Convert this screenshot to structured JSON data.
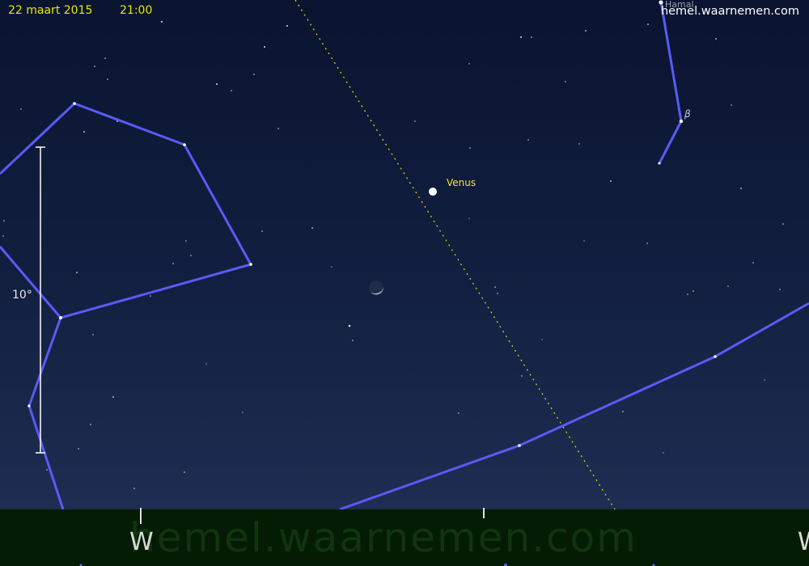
{
  "header": {
    "date": "22 maart 2015",
    "time": "21:00",
    "site": "hemel.waarnemen.com"
  },
  "scale": {
    "label": "10°"
  },
  "objects": {
    "venus": "Venus",
    "hamal": "Hamal",
    "beta": "β"
  },
  "watermark": "hemel.waarnemen.com",
  "compass": {
    "left": "W",
    "right": "W"
  },
  "colors": {
    "sky_top": "#0b1530",
    "sky_bottom": "#1c2d50",
    "ground": "#041c04",
    "constellation_lines": "#5a5af5",
    "ecliptic": "#e0e000",
    "header_text": "#e8e800"
  },
  "icons": {
    "moon": "crescent-moon-icon",
    "planet": "venus-disc-icon"
  }
}
